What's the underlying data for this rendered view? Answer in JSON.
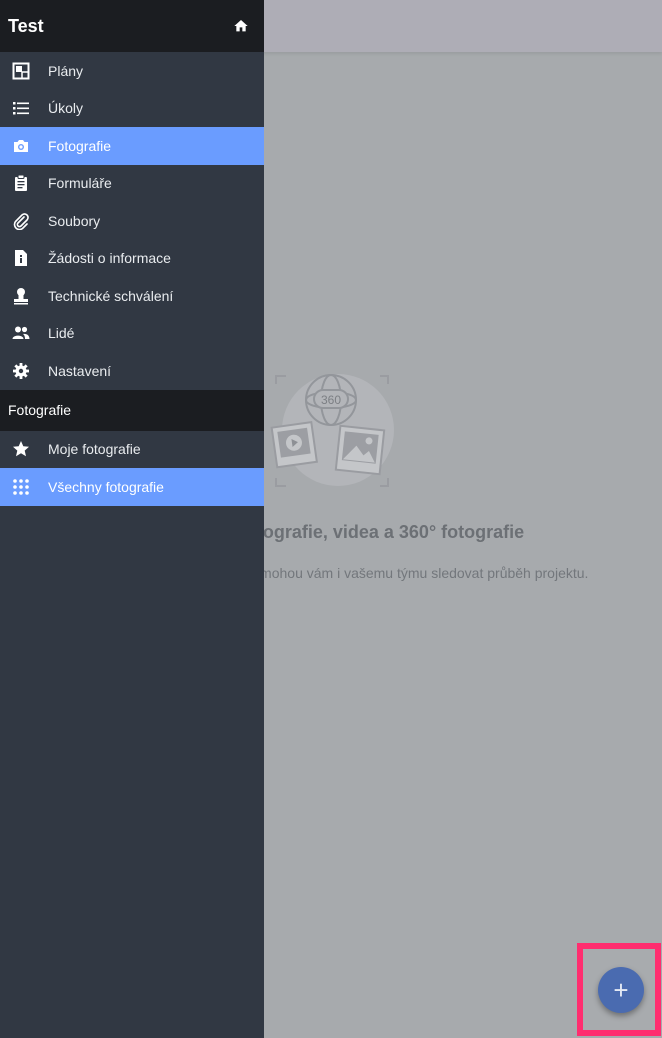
{
  "header": {
    "title": "Test"
  },
  "nav": {
    "items": [
      {
        "label": "Plány",
        "icon": "plans-icon"
      },
      {
        "label": "Úkoly",
        "icon": "list-icon"
      },
      {
        "label": "Fotografie",
        "icon": "camera-icon",
        "active": true
      },
      {
        "label": "Formuláře",
        "icon": "clipboard-icon"
      },
      {
        "label": "Soubory",
        "icon": "paperclip-icon"
      },
      {
        "label": "Žádosti o informace",
        "icon": "info-document-icon"
      },
      {
        "label": "Technické schválení",
        "icon": "stamp-icon"
      },
      {
        "label": "Lidé",
        "icon": "people-icon"
      },
      {
        "label": "Nastavení",
        "icon": "gear-icon"
      }
    ]
  },
  "photos_section": {
    "title": "Fotografie",
    "items": [
      {
        "label": "Moje fotografie",
        "icon": "star-icon"
      },
      {
        "label": "Všechny fotografie",
        "icon": "grid-icon",
        "active": true
      }
    ]
  },
  "empty_state": {
    "title": "ografie, videa a 360° fotografie",
    "description": "dány a pomohou vám i vašemu týmu sledovat průběh projektu.",
    "badge": "360"
  },
  "fab": {
    "label": "+"
  },
  "colors": {
    "active": "#6a9cff",
    "drawer": "#313843",
    "header": "#1b1d21",
    "highlight": "#ff2d6f",
    "fab": "#4a6bb0"
  }
}
